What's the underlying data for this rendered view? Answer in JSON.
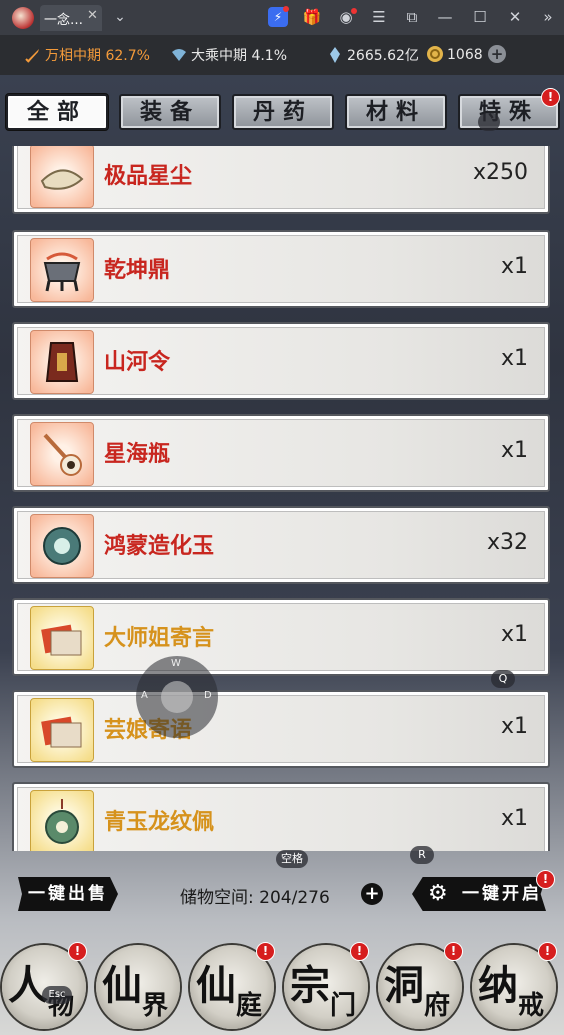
{
  "titlebar": {
    "tab_title": "一念…",
    "close": "✕",
    "dropdown": "⌄",
    "window_icons": [
      "bolt-icon",
      "gift-icon",
      "user-icon",
      "menu-icon",
      "popout-icon",
      "minimize-icon",
      "maximize-icon",
      "close-icon",
      "expand-icon"
    ]
  },
  "stats": {
    "realm1_label": "万相中期",
    "realm1_value": "62.7%",
    "realm2_label": "大乘中期",
    "realm2_value": "4.1%",
    "spirit_stones": "2665.62亿",
    "gold": "1068"
  },
  "categories": [
    {
      "label": "全部",
      "active": true
    },
    {
      "label": "装备",
      "active": false
    },
    {
      "label": "丹药",
      "active": false
    },
    {
      "label": "材料",
      "active": false
    },
    {
      "label": "特殊",
      "active": false,
      "badge": "!"
    }
  ],
  "items": [
    {
      "name": "极品星尘",
      "qty": "x250",
      "rarity": "red",
      "icon": "stardust-icon"
    },
    {
      "name": "乾坤鼎",
      "qty": "x1",
      "rarity": "red",
      "icon": "cauldron-icon"
    },
    {
      "name": "山河令",
      "qty": "x1",
      "rarity": "red",
      "icon": "token-icon"
    },
    {
      "name": "星海瓶",
      "qty": "x1",
      "rarity": "red",
      "icon": "bottle-icon"
    },
    {
      "name": "鸿蒙造化玉",
      "qty": "x32",
      "rarity": "red",
      "icon": "jade-icon"
    },
    {
      "name": "大师姐寄言",
      "qty": "x1",
      "rarity": "gold",
      "icon": "letter-icon"
    },
    {
      "name": "芸娘寄语",
      "qty": "x1",
      "rarity": "gold",
      "icon": "letter-icon"
    },
    {
      "name": "青玉龙纹佩",
      "qty": "x1",
      "rarity": "gold",
      "icon": "pendant-icon"
    }
  ],
  "bottom": {
    "sell_all": "一键出售",
    "storage_label": "储物空间:",
    "storage_value": "204/276",
    "open_all": "一键开启",
    "open_all_badge": "!"
  },
  "nav": [
    {
      "big": "人",
      "small": "物",
      "badge": "!",
      "key": "Esc",
      "dark": false
    },
    {
      "big": "仙",
      "small": "界",
      "badge": "",
      "key": "",
      "dark": false
    },
    {
      "big": "仙",
      "small": "庭",
      "badge": "!",
      "key": "",
      "dark": false
    },
    {
      "big": "宗",
      "small": "门",
      "badge": "!",
      "key": "",
      "dark": false
    },
    {
      "big": "洞",
      "small": "府",
      "badge": "!",
      "key": "",
      "dark": false
    },
    {
      "big": "纳",
      "small": "戒",
      "badge": "!",
      "key": "",
      "dark": false
    }
  ],
  "key_hints": {
    "q": "Q",
    "space": "空格",
    "r": "R",
    "w": "W",
    "a": "A",
    "d": "D"
  },
  "colors": {
    "red_rarity": "#c8261f",
    "gold_rarity": "#d6921c",
    "badge": "#d61e1e",
    "realm_orange": "#f39a3a"
  }
}
